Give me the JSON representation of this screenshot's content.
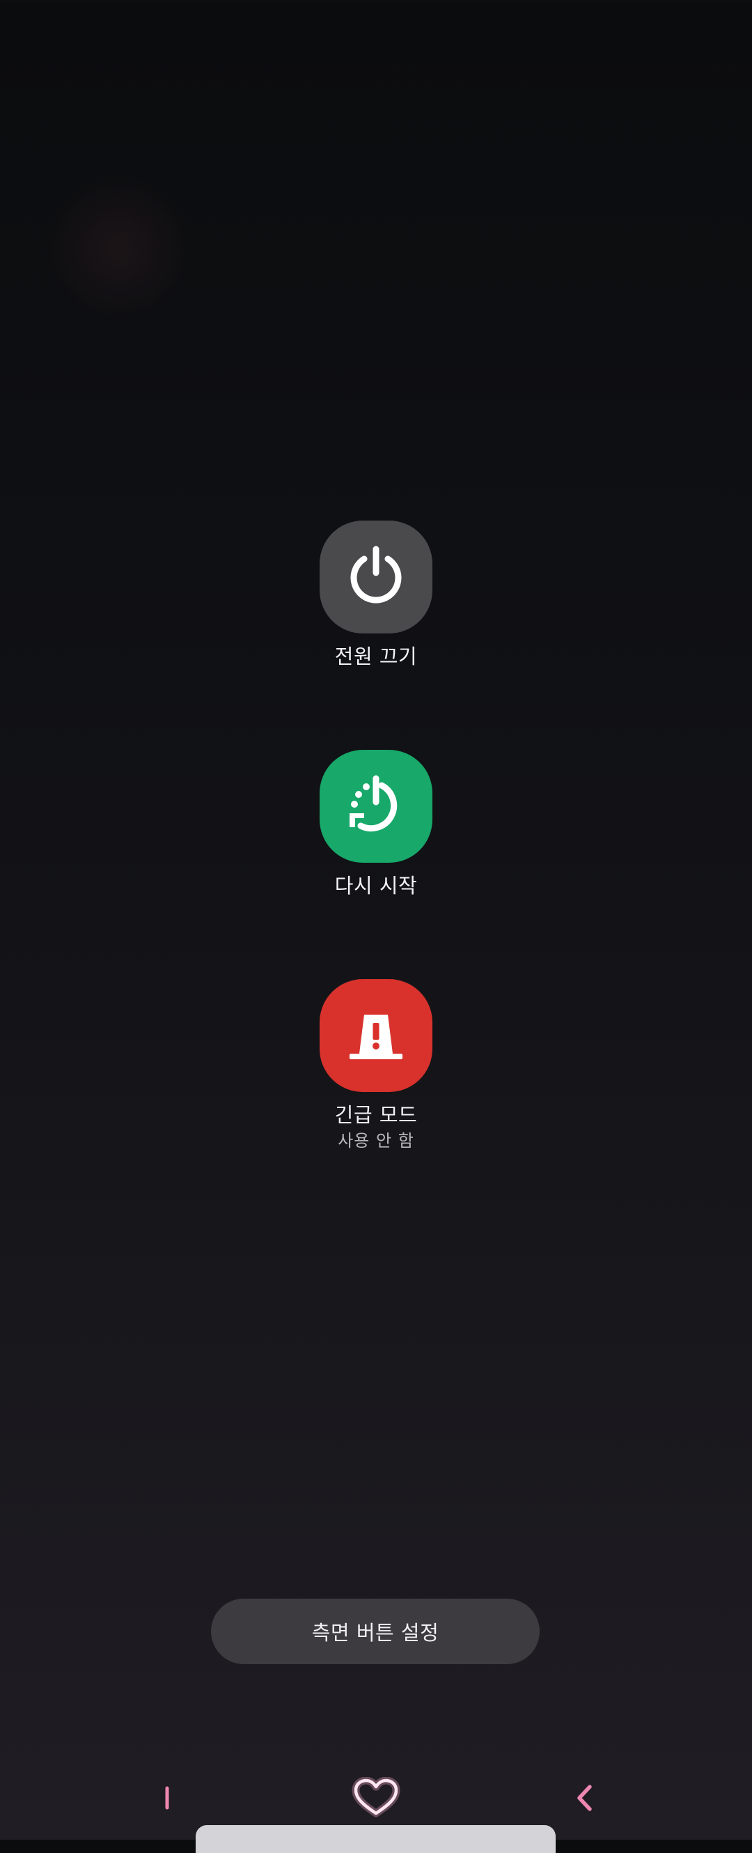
{
  "power_menu": {
    "power_off": {
      "label": "전원 끄기",
      "icon": "power-icon",
      "color": "#4a4a4c"
    },
    "restart": {
      "label": "다시 시작",
      "icon": "restart-icon",
      "color": "#17a86a"
    },
    "emergency": {
      "label": "긴급 모드",
      "status": "사용 안 함",
      "icon": "emergency-beacon-icon",
      "color": "#d9322c"
    }
  },
  "side_button_settings": {
    "label": "측면 버튼 설정"
  },
  "navigation_bar": {
    "recents": {
      "icon": "recents-icon"
    },
    "home": {
      "icon": "heart-home-icon"
    },
    "back": {
      "icon": "back-chevron-icon"
    },
    "accent_color": "#ef87b2"
  }
}
